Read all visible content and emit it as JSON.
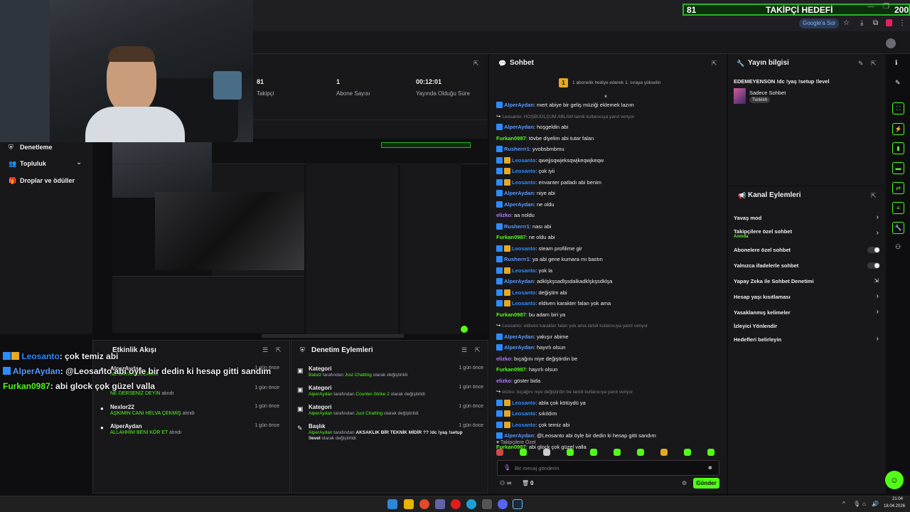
{
  "browser": {
    "goal_value": "81",
    "goal_label": "TAKİPÇİ HEDEFİ",
    "goal_total": "200",
    "google_pill": "Google'a Sor"
  },
  "left_nav": {
    "items": [
      {
        "label": "Denetleme",
        "icon": "shield-icon"
      },
      {
        "label": "Topluluk",
        "icon": "users-icon"
      },
      {
        "label": "Droplar ve ödüller",
        "icon": "gift-icon"
      }
    ]
  },
  "stats": [
    {
      "value": "81",
      "label": "Takipçi"
    },
    {
      "value": "1",
      "label": "Abone Sayısı"
    },
    {
      "value": "00:12:01",
      "label": "Yayında Olduğu Süre"
    }
  ],
  "overlay_chat": [
    {
      "user": "Leosanto",
      "text": ": çok temiz abi",
      "color": "#2d8cff"
    },
    {
      "user": "AlperAydan",
      "text": ": @Leosanto abi öyle bir dedin ki hesap gitti sandım",
      "color": "#5b9bff"
    },
    {
      "user": "Furkan0987",
      "text": ": abi glock çok güzel valla",
      "color": "#53fc18"
    }
  ],
  "activity": {
    "title": "Etkinlik Akışı",
    "items": [
      {
        "name": "AlperAydan",
        "sub": "NE DAYAN OLCAMM",
        "time": "1 gün önce"
      },
      {
        "name": "",
        "sub": "NE DERSENİZ DEYİN",
        "sub_suffix": "alındı",
        "time": "1 gün önce"
      },
      {
        "name": "Nexlor22",
        "sub": "AŞKIMIN CANI HELVA ÇEKMİŞ",
        "sub_suffix": "alındı",
        "time": "1 gün önce"
      },
      {
        "name": "AlperAydan",
        "sub": "ALLAHHIM BENİ KÖR ET",
        "sub_suffix": "alındı",
        "time": "1 gün önce"
      }
    ]
  },
  "moderation": {
    "title": "Denetim Eylemleri",
    "items": [
      {
        "type": "Kategori",
        "actor": "Batulz",
        "middle": " tarafından ",
        "target": "Just Chatting",
        "suffix": " olarak değiştirildi",
        "time": "1 gün önce"
      },
      {
        "type": "Kategori",
        "actor": "AlperAydan",
        "middle": " tarafından ",
        "target": "Counter-Strike 2",
        "suffix": " olarak değiştirildi",
        "time": "1 gün önce"
      },
      {
        "type": "Kategori",
        "actor": "AlperAydan",
        "middle": " tarafından ",
        "target": "Just Chatting",
        "suffix": " olarak değiştirildi",
        "time": "1 gün önce"
      },
      {
        "type": "Başlık",
        "actor": "AlperAydan",
        "middle": " tarafından ",
        "target": "AKSAKLIK BİR TEKNİK MİDİR ?? !dc !yaş !setup !level",
        "suffix": " olarak değiştirildi",
        "time": "1 gün önce"
      }
    ]
  },
  "chat": {
    "title": "Sohbet",
    "pinned": "1 abonelik hediye ederek 1. sıraya yükselin",
    "pinned_rank": "1",
    "messages": [
      {
        "kind": "msg",
        "user": "AlperAydan",
        "text": ": mert abiye bir geliş müziği eklemek lazım",
        "color": "#5b9bff",
        "badges": [
          "blue"
        ]
      },
      {
        "kind": "reply",
        "text": "Leosanto: HOŞBUDLŞUM ABLAM lamili kullanıcıya yanıt veriyor"
      },
      {
        "kind": "msg",
        "user": "AlperAydan",
        "text": ": hoşgeldin abi",
        "color": "#5b9bff",
        "badges": [
          "blue"
        ]
      },
      {
        "kind": "msg",
        "user": "Furkan0987",
        "text": ": tövbe diyelim abi tutar falan",
        "color": "#53fc18",
        "badges": []
      },
      {
        "kind": "msg",
        "user": "Rusherrr1",
        "text": ": yvobsbmbmu",
        "color": "#5b9bff",
        "badges": [
          "blue"
        ]
      },
      {
        "kind": "msg",
        "user": "Leosanto",
        "text": ": qwejjsqwjeksqwjkeqwjkeqw",
        "color": "#2d8cff",
        "badges": [
          "blue",
          "gold"
        ]
      },
      {
        "kind": "msg",
        "user": "Leosanto",
        "text": ": çok iyii",
        "color": "#2d8cff",
        "badges": [
          "blue",
          "gold"
        ]
      },
      {
        "kind": "msg",
        "user": "Leosanto",
        "text": ": envanter patladı abi benim",
        "color": "#2d8cff",
        "badges": [
          "blue",
          "gold"
        ]
      },
      {
        "kind": "msg",
        "user": "AlperAydan",
        "text": ": niye abi",
        "color": "#5b9bff",
        "badges": [
          "blue"
        ]
      },
      {
        "kind": "msg",
        "user": "AlperAydan",
        "text": ": ne oldu",
        "color": "#5b9bff",
        "badges": [
          "blue"
        ]
      },
      {
        "kind": "msg",
        "user": "elizko",
        "text": ": aa noldu",
        "color": "#b07cff",
        "badges": []
      },
      {
        "kind": "msg",
        "user": "Rusherrr1",
        "text": ": nası abi",
        "color": "#5b9bff",
        "badges": [
          "blue"
        ]
      },
      {
        "kind": "msg",
        "user": "Furkan0987",
        "text": ": ne oldu abi",
        "color": "#53fc18",
        "badges": []
      },
      {
        "kind": "msg",
        "user": "Leosanto",
        "text": ": steam profilime gir",
        "color": "#2d8cff",
        "badges": [
          "blue",
          "gold"
        ]
      },
      {
        "kind": "msg",
        "user": "Rusherrr1",
        "text": ": ya abi gene kumara mı bastın",
        "color": "#5b9bff",
        "badges": [
          "blue"
        ]
      },
      {
        "kind": "msg",
        "user": "Leosanto",
        "text": ": yok la",
        "color": "#2d8cff",
        "badges": [
          "blue",
          "gold"
        ]
      },
      {
        "kind": "msg",
        "user": "AlperAydan",
        "text": ": adklşkşsadlşsdalkadklşkşsdklşa",
        "color": "#5b9bff",
        "badges": [
          "blue"
        ]
      },
      {
        "kind": "msg",
        "user": "Leosanto",
        "text": ": değiştim abi",
        "color": "#2d8cff",
        "badges": [
          "blue",
          "gold"
        ]
      },
      {
        "kind": "msg",
        "user": "Leosanto",
        "text": ": eldiven karakter falan yok ama",
        "color": "#2d8cff",
        "badges": [
          "blue",
          "gold"
        ]
      },
      {
        "kind": "msg",
        "user": "Furkan0987",
        "text": ": bu adam biri ya",
        "color": "#53fc18",
        "badges": []
      },
      {
        "kind": "reply",
        "text": "Leosanto: eldiven karakter falan yok ama lamili kullanıcıya yanıt veriyor"
      },
      {
        "kind": "msg",
        "user": "AlperAydan",
        "text": ": yakışır abime",
        "color": "#5b9bff",
        "badges": [
          "blue"
        ]
      },
      {
        "kind": "msg",
        "user": "AlperAydan",
        "text": ": hayırlı olsun",
        "color": "#5b9bff",
        "badges": [
          "blue"
        ]
      },
      {
        "kind": "msg",
        "user": "elizko",
        "text": ": bıçağını niye değiştirdin be",
        "color": "#b07cff",
        "badges": []
      },
      {
        "kind": "msg",
        "user": "Furkan0987",
        "text": ": hayırlı olsun",
        "color": "#53fc18",
        "badges": []
      },
      {
        "kind": "msg",
        "user": "elizko",
        "text": ": göster bida",
        "color": "#b07cff",
        "badges": []
      },
      {
        "kind": "reply",
        "text": "elizko: bıçağını niye değiştirdin be lamili kullanıcıya yanıt veriyor"
      },
      {
        "kind": "msg",
        "user": "Leosanto",
        "text": ": abla çok kötüydü ya",
        "color": "#2d8cff",
        "badges": [
          "blue",
          "gold"
        ]
      },
      {
        "kind": "msg",
        "user": "Leosanto",
        "text": ": sıkıldım",
        "color": "#2d8cff",
        "badges": [
          "blue",
          "gold"
        ]
      },
      {
        "kind": "msg",
        "user": "Leosanto",
        "text": ": çok temiz abi",
        "color": "#2d8cff",
        "badges": [
          "blue",
          "gold"
        ]
      },
      {
        "kind": "msg",
        "user": "AlperAydan",
        "text": ": @Leosanto abi öyle bir dedin ki hesap gitti sandım",
        "color": "#5b9bff",
        "badges": [
          "blue"
        ]
      },
      {
        "kind": "msg",
        "user": "Furkan0987",
        "text": ": abi glock çok güzel valla",
        "color": "#53fc18",
        "badges": []
      }
    ],
    "followers_only_label": "Takipçilere Özel",
    "input_placeholder": "Bir mesaj gönderin",
    "counter_left": "∞",
    "counter_right": "0",
    "send_label": "Gönder"
  },
  "stream_info": {
    "title": "Yayın bilgisi",
    "stream_title": "EDEMEYENSON !dc !yaş !setup !level",
    "category": "Sadece Sohbet",
    "language": "Turkish"
  },
  "channel_actions": {
    "title": "Kanal Eylemleri",
    "items": [
      {
        "label": "Yavaş mod",
        "control": "chevron"
      },
      {
        "label": "Takipçilere özel sohbet",
        "sub": "Anında",
        "control": "chevron"
      },
      {
        "label": "Abonelere özel sohbet",
        "control": "toggle"
      },
      {
        "label": "Yalnızca ifadelerle sohbet",
        "control": "toggle"
      },
      {
        "label": "Yapay Zeka ile Sohbet Denetimi",
        "control": "external"
      },
      {
        "label": "Hesap yaşı kısıtlaması",
        "control": "chevron"
      },
      {
        "label": "Yasaklanmış kelimeler",
        "control": "chevron"
      },
      {
        "label": "İzleyici Yönlendir",
        "control": "none"
      },
      {
        "label": "Hedefleri belirleyin",
        "control": "chevron"
      }
    ]
  },
  "taskbar": {
    "time": "21:04",
    "date": "18.04.2026"
  },
  "colors": {
    "accent": "#53fc18",
    "panel": "#18181b",
    "background": "#0e0e10"
  }
}
